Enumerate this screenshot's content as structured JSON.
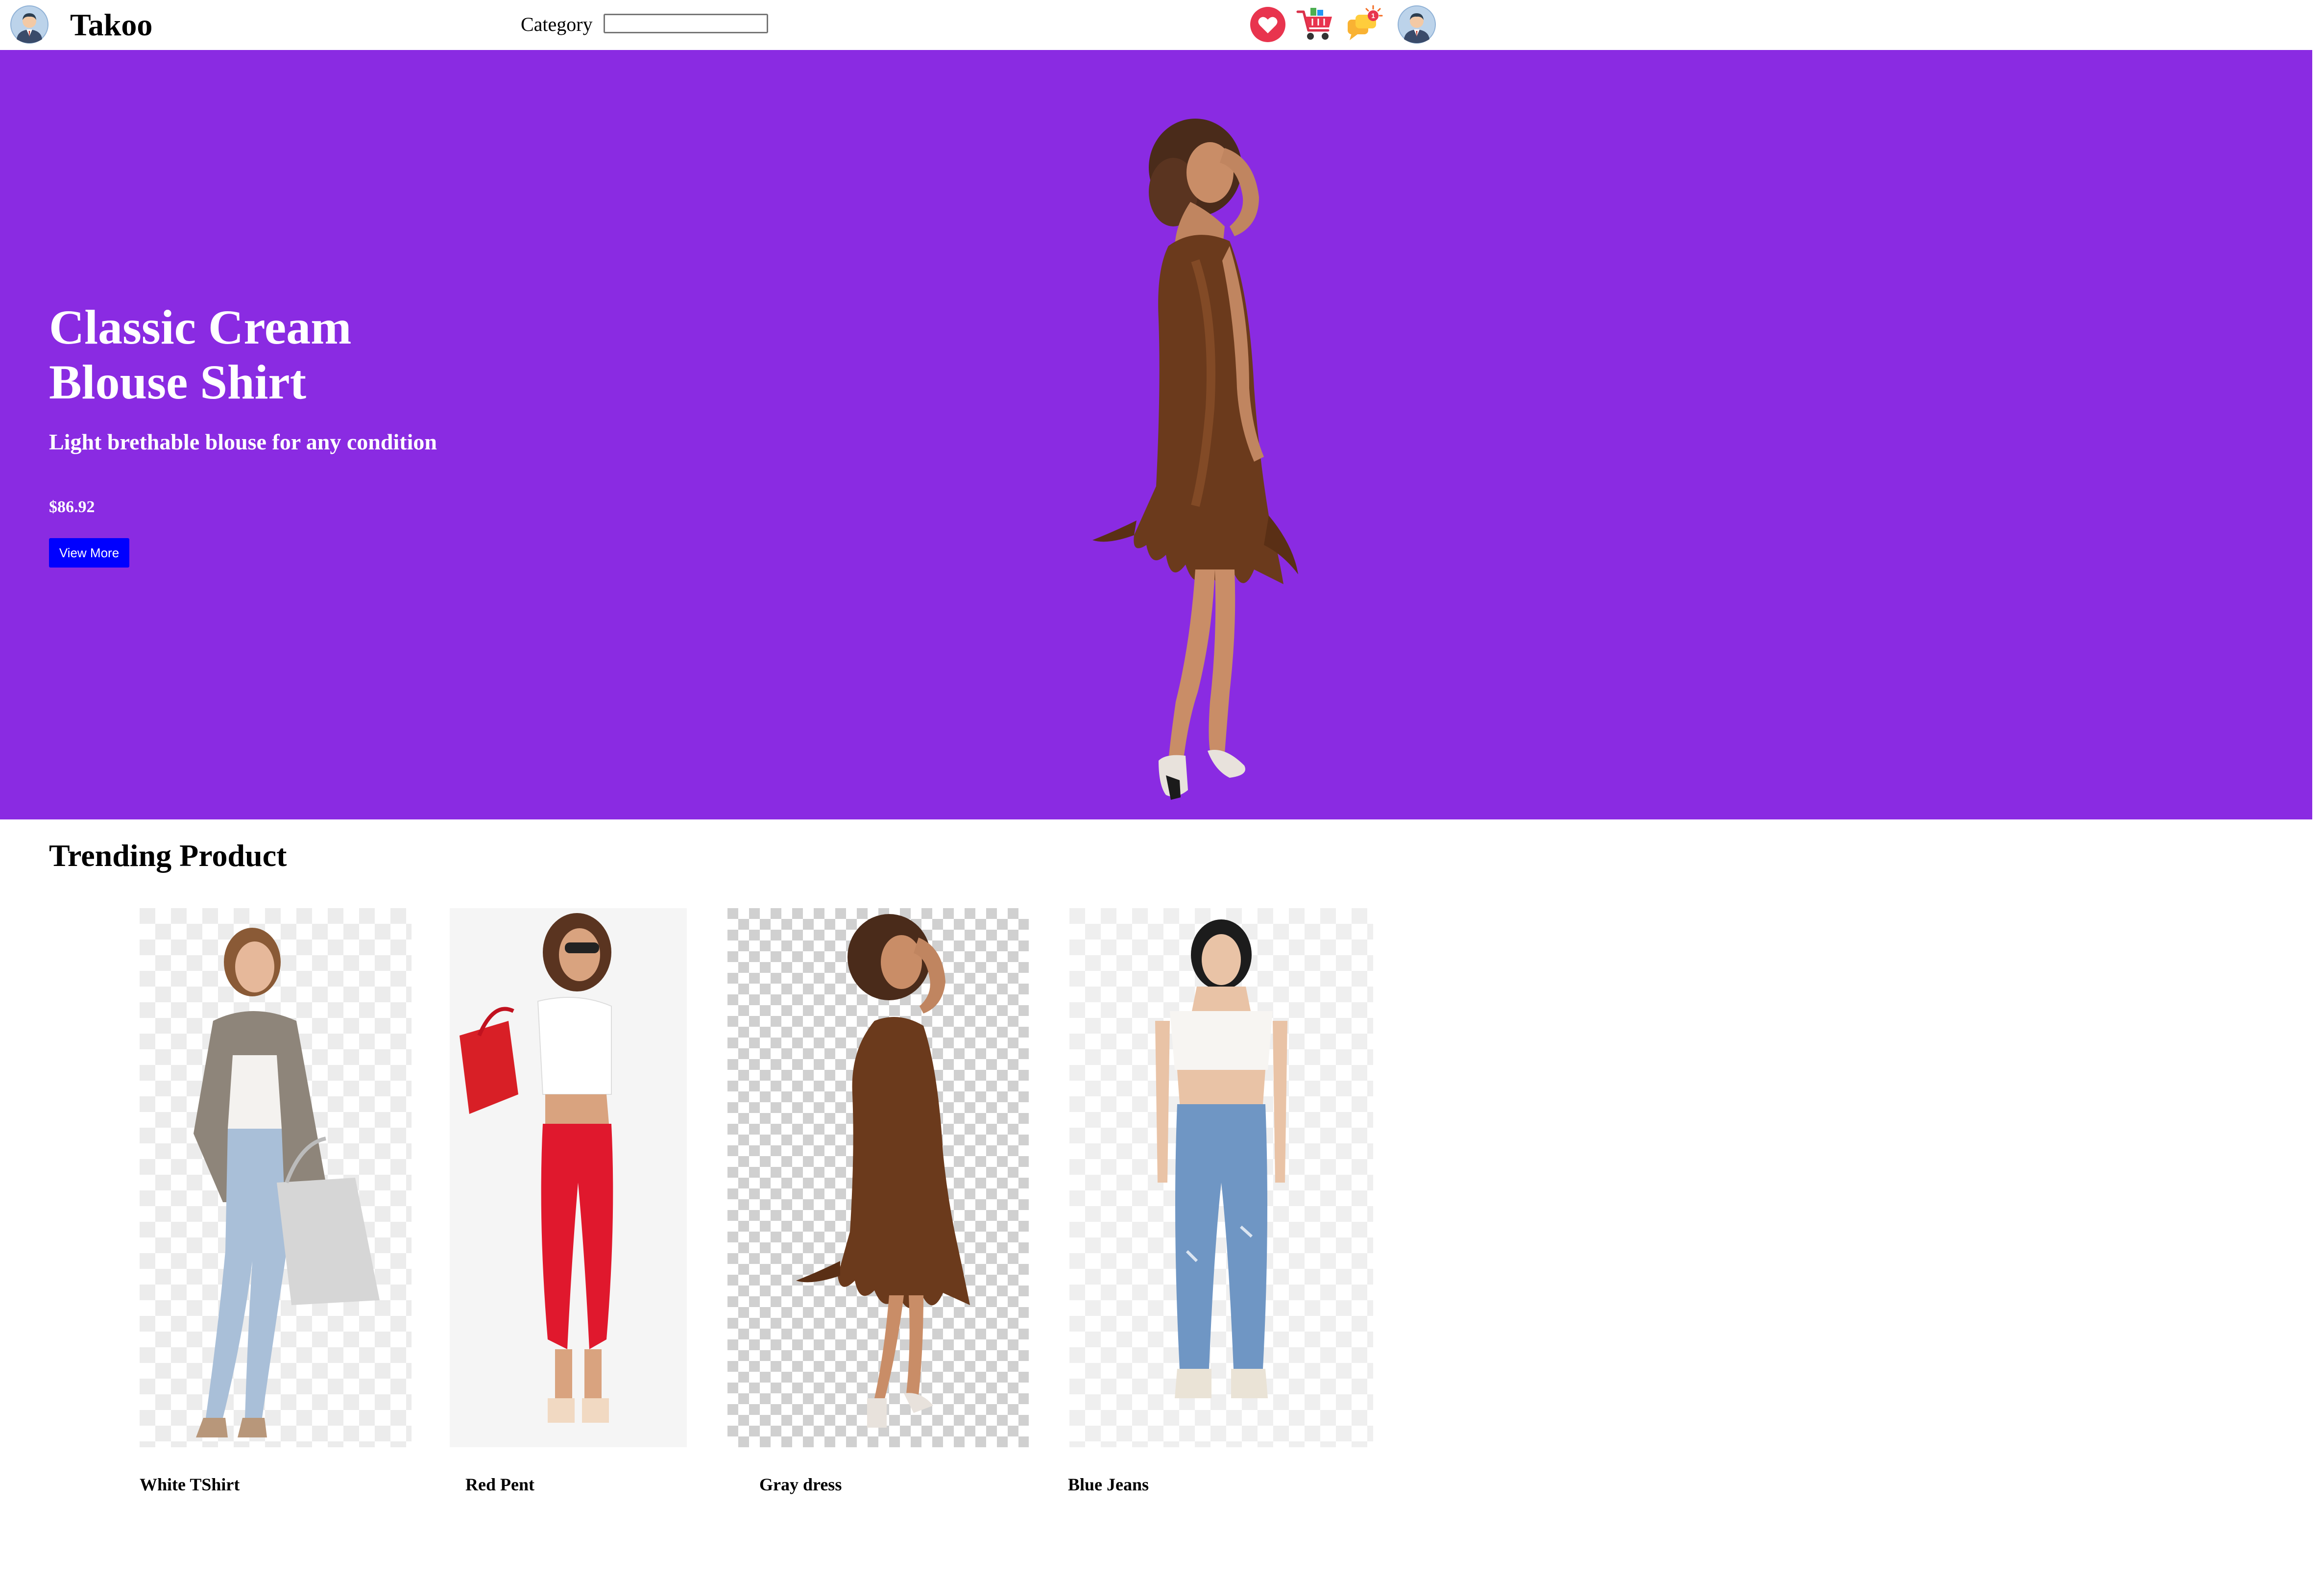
{
  "header": {
    "brand": "Takoo",
    "category_label": "Category",
    "category_value": "",
    "left_avatar_icon": "user-avatar-icon",
    "icons": [
      "heart-icon",
      "shopping-cart-icon",
      "notification-chat-icon",
      "user-avatar-icon"
    ],
    "notification_badge": "1"
  },
  "hero": {
    "title_line1": "Classic Cream",
    "title_line2": "Blouse Shirt",
    "subtitle": "Light brethable blouse for any condition",
    "price": "$86.92",
    "button_label": "View More",
    "background_color": "#8a2be2",
    "button_color": "#0000ff"
  },
  "trending": {
    "title": "Trending Product",
    "products": [
      {
        "name": "White TShirt"
      },
      {
        "name": "Red Pent"
      },
      {
        "name": "Gray dress"
      },
      {
        "name": "Blue Jeans"
      }
    ]
  }
}
